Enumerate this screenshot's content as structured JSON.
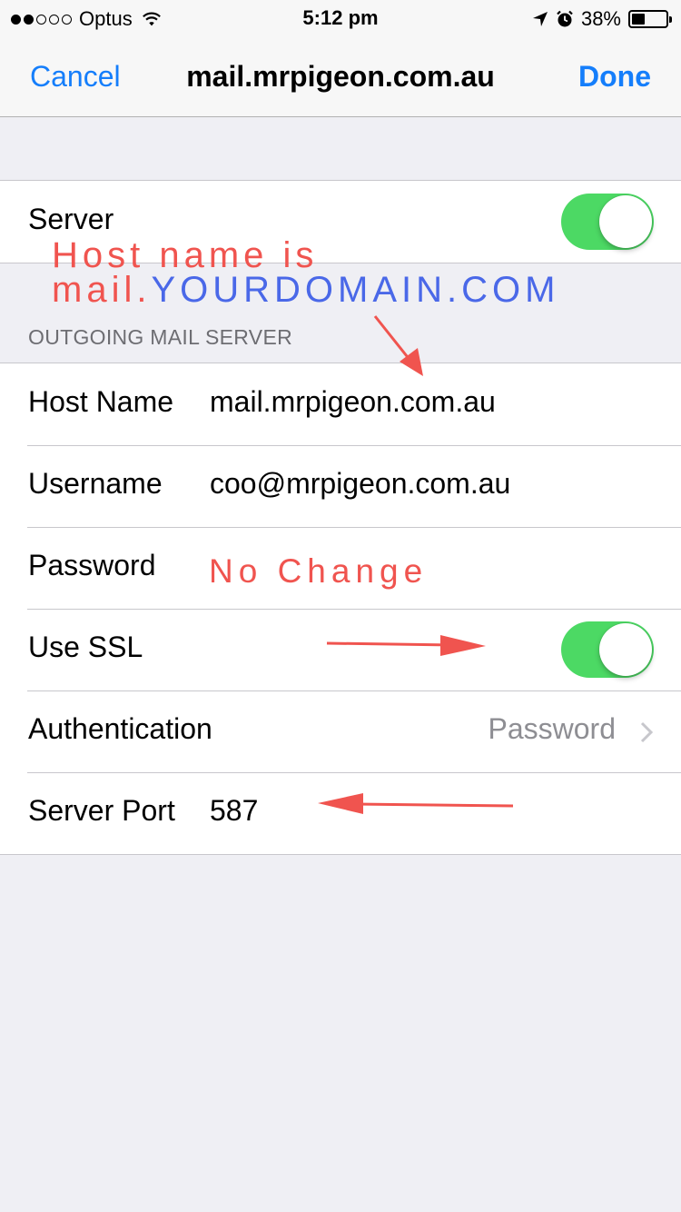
{
  "status_bar": {
    "carrier": "Optus",
    "time": "5:12 pm",
    "battery_percent": "38%",
    "battery_level": 0.38,
    "signal_bars_filled": 2,
    "signal_bars_total": 5
  },
  "nav": {
    "cancel_label": "Cancel",
    "title": "mail.mrpigeon.com.au",
    "done_label": "Done"
  },
  "server_toggle": {
    "label": "Server",
    "on": true
  },
  "outgoing": {
    "section_header": "OUTGOING MAIL SERVER",
    "host_name_label": "Host Name",
    "host_name_value": "mail.mrpigeon.com.au",
    "username_label": "Username",
    "username_value": "coo@mrpigeon.com.au",
    "password_label": "Password",
    "use_ssl_label": "Use SSL",
    "use_ssl_on": true,
    "authentication_label": "Authentication",
    "authentication_value": "Password",
    "server_port_label": "Server Port",
    "server_port_value": "587"
  },
  "annotations": {
    "host_line1": "Host name is",
    "host_prefix": "mail.",
    "host_domain": "YOURDOMAIN.COM",
    "no_change": "No Change"
  },
  "colors": {
    "ios_blue": "#157efb",
    "toggle_green": "#4cd964",
    "annotation_red": "#f0544f",
    "annotation_blue": "#4a68e8"
  }
}
